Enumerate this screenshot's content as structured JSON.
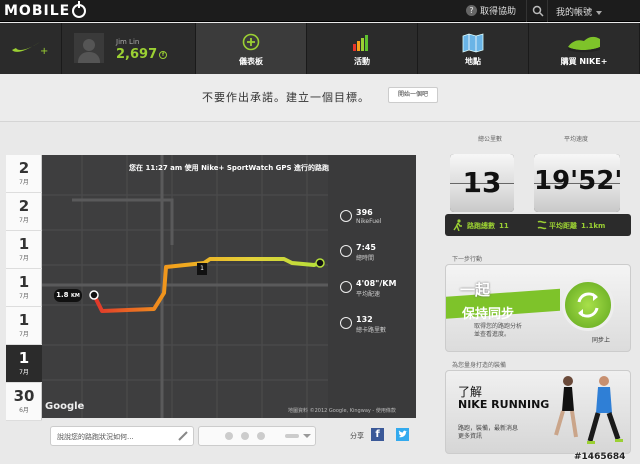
{
  "brand": {
    "logo_text": "MOBILE"
  },
  "topbar": {
    "help": "取得協助",
    "account": "我的帳號"
  },
  "nav": {
    "user_name": "Jim Lin",
    "fuel": "2,697",
    "items": [
      {
        "label": "儀表板",
        "icon": "plus-circle-icon",
        "active": true
      },
      {
        "label": "活動",
        "icon": "bar-chart-icon",
        "active": false
      },
      {
        "label": "地點",
        "icon": "map-icon",
        "active": false
      },
      {
        "label": "購買 NIKE+",
        "icon": "shoe-icon",
        "active": false
      }
    ]
  },
  "banner": {
    "message": "不要作出承諾。建立一個目標。",
    "button": "開始一個吧"
  },
  "dates": [
    {
      "day": "2",
      "month": "7月"
    },
    {
      "day": "2",
      "month": "7月"
    },
    {
      "day": "1",
      "month": "7月"
    },
    {
      "day": "1",
      "month": "7月"
    },
    {
      "day": "1",
      "month": "7月"
    },
    {
      "day": "1",
      "month": "7月",
      "selected": true
    },
    {
      "day": "30",
      "month": "6月"
    }
  ],
  "map": {
    "caption": "您在 11:27 am 使用 Nike+ SportWatch GPS 進行的路跑",
    "start_distance": "1.8",
    "start_unit": "KM",
    "marker": "1",
    "google": "Google",
    "copyright": "地圖資料 ©2012 Google, Kingway - 使用條款"
  },
  "stats": [
    {
      "value": "396",
      "label": "NikeFuel",
      "icon": "fuel-icon"
    },
    {
      "value": "7:45",
      "label": "總時間",
      "icon": "clock-icon"
    },
    {
      "value": "4'08\"/KM",
      "label": "平均配速",
      "icon": "pace-icon"
    },
    {
      "value": "132",
      "label": "總卡路里數",
      "icon": "flame-icon"
    }
  ],
  "social": {
    "placeholder": "說說您的路跑狀況如何...",
    "share": "分享",
    "facebook": "f"
  },
  "summary": {
    "total_runs_label": "總公里數",
    "total_runs": "13",
    "avg_pace_label": "平均速度",
    "avg_pace": "19'52\"",
    "runs_label": "路跑總數",
    "runs": "11",
    "avg_dist_label": "平均距離",
    "avg_dist": "1.1km"
  },
  "next_step": {
    "label": "下一步行動",
    "title1": "一起",
    "title2": "保持同步",
    "desc1": "取得您的路跑分析",
    "desc2": "並查看進度。",
    "link": "同步上"
  },
  "gear": {
    "label": "為您量身打造的裝備",
    "title1": "了解",
    "title2": "NIKE RUNNING",
    "desc1": "路跑，裝備，最新消息",
    "desc2": "更多資訊"
  },
  "watermark": "#1465684",
  "colors": {
    "accent": "#9bd033",
    "route_start": "#e0352b",
    "route_end": "#b6e03a"
  }
}
